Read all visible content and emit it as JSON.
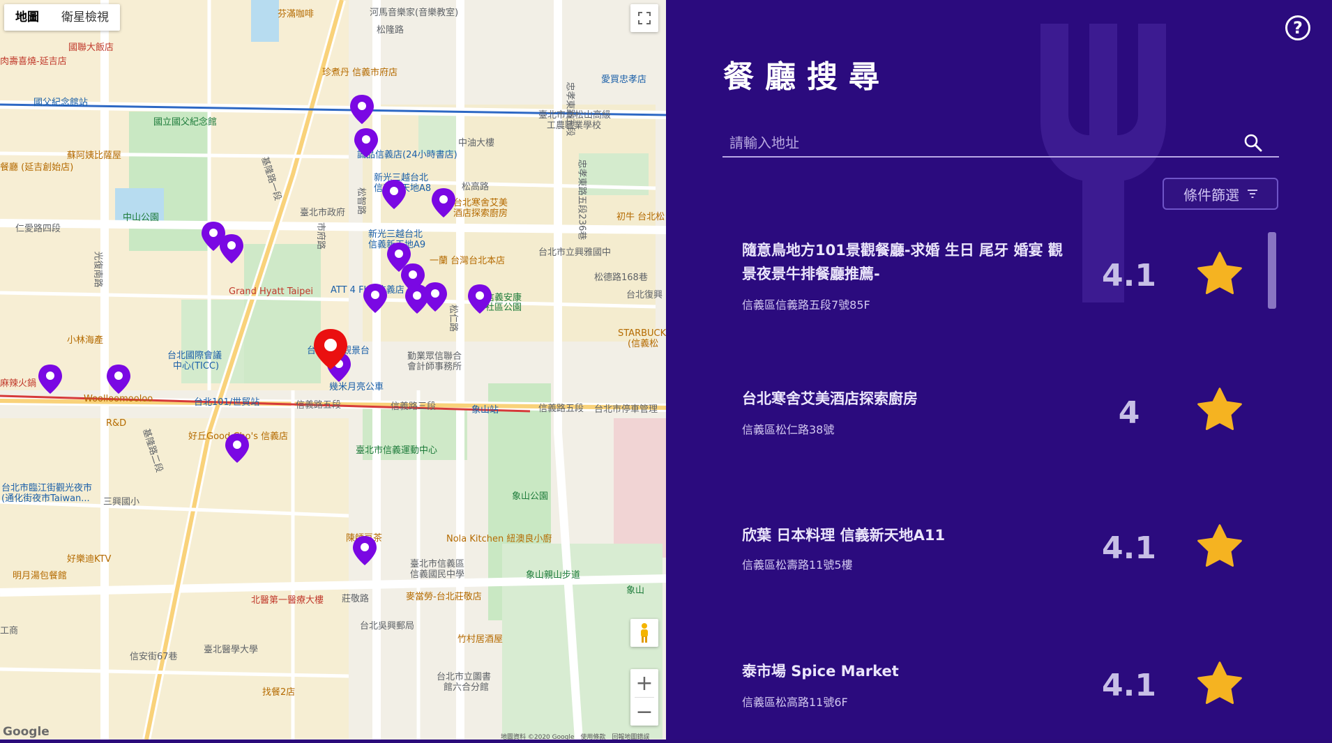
{
  "map": {
    "type_tabs": [
      "地圖",
      "衛星檢視"
    ],
    "google_logo": "Google",
    "attribution": "地圖資料 ©2020 Google　使用條款　回報地圖錯誤",
    "labels": [
      {
        "text": "芬滿咖啡",
        "cls": "lbl-orange"
      },
      {
        "text": "河馬音樂家(音樂教室)",
        "cls": "lbl-gray"
      },
      {
        "text": "松隆路",
        "cls": "lbl-gray"
      },
      {
        "text": "國聯大飯店",
        "cls": "lbl-red"
      },
      {
        "text": "肉壽喜燒-延吉店",
        "cls": "lbl-red"
      },
      {
        "text": "珍煮丹 信義市府店",
        "cls": "lbl-orange"
      },
      {
        "text": "愛買忠孝店",
        "cls": "lbl-blue"
      },
      {
        "text": "國父紀念館站",
        "cls": "lbl-blue"
      },
      {
        "text": "國立國父紀念館",
        "cls": "lbl-green"
      },
      {
        "text": "臺北市立松山高級",
        "cls": "lbl-gray"
      },
      {
        "text": "工農職業學校",
        "cls": "lbl-gray"
      },
      {
        "text": "中油大樓",
        "cls": "lbl-gray"
      },
      {
        "text": "誠品信義店(24小時書店)",
        "cls": "lbl-blue"
      },
      {
        "text": "蘇阿姨比薩屋",
        "cls": "lbl-orange"
      },
      {
        "text": "餐廳 (延吉創始店)",
        "cls": "lbl-orange"
      },
      {
        "text": "新光三越台北",
        "cls": "lbl-blue"
      },
      {
        "text": "信義新天地A8",
        "cls": "lbl-blue"
      },
      {
        "text": "松高路",
        "cls": "lbl-gray"
      },
      {
        "text": "台北寒舍艾美",
        "cls": "lbl-orange"
      },
      {
        "text": "酒店探索廚房",
        "cls": "lbl-orange"
      },
      {
        "text": "中山公園",
        "cls": "lbl-green"
      },
      {
        "text": "臺北市政府",
        "cls": "lbl-gray"
      },
      {
        "text": "初牛 台北松",
        "cls": "lbl-orange"
      },
      {
        "text": "仁愛路四段",
        "cls": "lbl-gray"
      },
      {
        "text": "新光三越台北",
        "cls": "lbl-blue"
      },
      {
        "text": "信義新天地A9",
        "cls": "lbl-blue"
      },
      {
        "text": "一蘭 台灣台北本店",
        "cls": "lbl-orange"
      },
      {
        "text": "台北市立興雅國中",
        "cls": "lbl-gray"
      },
      {
        "text": "松德路168巷",
        "cls": "lbl-gray"
      },
      {
        "text": "Grand Hyatt Taipei",
        "cls": "lbl-red"
      },
      {
        "text": "ATT 4 FUN信義店",
        "cls": "lbl-blue"
      },
      {
        "text": "信義安康",
        "cls": "lbl-green"
      },
      {
        "text": "社區公園",
        "cls": "lbl-green"
      },
      {
        "text": "台北復興",
        "cls": "lbl-gray"
      },
      {
        "text": "STARBUCKS",
        "cls": "lbl-orange"
      },
      {
        "text": "(信義松",
        "cls": "lbl-orange"
      },
      {
        "text": "小林海產",
        "cls": "lbl-orange"
      },
      {
        "text": "台北國際會議",
        "cls": "lbl-blue"
      },
      {
        "text": "中心(TICC)",
        "cls": "lbl-blue"
      },
      {
        "text": "台北101觀景台",
        "cls": "lbl-blue"
      },
      {
        "text": "勤業眾信聯合",
        "cls": "lbl-gray"
      },
      {
        "text": "會計師事務所",
        "cls": "lbl-gray"
      },
      {
        "text": "幾米月亮公車",
        "cls": "lbl-blue"
      },
      {
        "text": "麻辣火鍋",
        "cls": "lbl-red"
      },
      {
        "text": "Woolloomooloo",
        "cls": "lbl-orange"
      },
      {
        "text": "台北101/世貿站",
        "cls": "lbl-blue"
      },
      {
        "text": "信義路五段",
        "cls": "lbl-gray"
      },
      {
        "text": "信義路三段",
        "cls": "lbl-gray"
      },
      {
        "text": "象山站",
        "cls": "lbl-blue"
      },
      {
        "text": "信義路五段",
        "cls": "lbl-gray"
      },
      {
        "text": "台北市停車管理",
        "cls": "lbl-gray"
      },
      {
        "text": "R&D",
        "cls": "lbl-orange"
      },
      {
        "text": "好丘Good Cho's 信義店",
        "cls": "lbl-orange"
      },
      {
        "text": "臺北市信義運動中心",
        "cls": "lbl-green"
      },
      {
        "text": "台北市臨江街觀光夜市",
        "cls": "lbl-blue"
      },
      {
        "text": "(通化街夜市Taiwan...",
        "cls": "lbl-blue"
      },
      {
        "text": "三興國小",
        "cls": "lbl-gray"
      },
      {
        "text": "象山公園",
        "cls": "lbl-green"
      },
      {
        "text": "陳師豆茶",
        "cls": "lbl-orange"
      },
      {
        "text": "Nola Kitchen 紐澳良小廚",
        "cls": "lbl-orange"
      },
      {
        "text": "臺北市信義區",
        "cls": "lbl-gray"
      },
      {
        "text": "信義國民中學",
        "cls": "lbl-gray"
      },
      {
        "text": "好樂迪KTV",
        "cls": "lbl-orange"
      },
      {
        "text": "象山親山步道",
        "cls": "lbl-green"
      },
      {
        "text": "明月湯包餐館",
        "cls": "lbl-orange"
      },
      {
        "text": "麥當勞-台北莊敬店",
        "cls": "lbl-orange"
      },
      {
        "text": "北醫第一醫療大樓",
        "cls": "lbl-red"
      },
      {
        "text": "莊敬路",
        "cls": "lbl-gray"
      },
      {
        "text": "象山",
        "cls": "lbl-green"
      },
      {
        "text": "台北吳興郵局",
        "cls": "lbl-gray"
      },
      {
        "text": "竹村居酒屋",
        "cls": "lbl-orange"
      },
      {
        "text": "臺北醫學大學",
        "cls": "lbl-gray"
      },
      {
        "text": "信安街67巷",
        "cls": "lbl-gray"
      },
      {
        "text": "找餐2店",
        "cls": "lbl-orange"
      },
      {
        "text": "台北市立圖書",
        "cls": "lbl-gray"
      },
      {
        "text": "館六合分館",
        "cls": "lbl-gray"
      },
      {
        "text": "工商",
        "cls": "lbl-gray"
      },
      {
        "text": "基隆路一段",
        "cls": "lbl-gray"
      },
      {
        "text": "基隆路二段",
        "cls": "lbl-gray"
      },
      {
        "text": "光復南路",
        "cls": "lbl-gray"
      },
      {
        "text": "忠孝東路五段",
        "cls": "lbl-gray"
      },
      {
        "text": "松仁路",
        "cls": "lbl-gray"
      },
      {
        "text": "市府路",
        "cls": "lbl-gray"
      },
      {
        "text": "松智路",
        "cls": "lbl-gray"
      },
      {
        "text": "忠孝東路五段236巷",
        "cls": "lbl-gray"
      }
    ]
  },
  "panel": {
    "title": "餐廳搜尋",
    "search_placeholder": "請輸入地址",
    "filter_label": "條件篩選",
    "help_label": "?",
    "accent": "#2b0b7e",
    "star_color": "#f5b321",
    "restaurants": [
      {
        "name": "隨意鳥地方101景觀餐廳-求婚 生日 尾牙 婚宴 觀景夜景牛排餐廳推薦-",
        "address": "信義區信義路五段7號85F",
        "rating": "4.1"
      },
      {
        "name": "台北寒舍艾美酒店探索廚房",
        "address": "信義區松仁路38號",
        "rating": "4"
      },
      {
        "name": "欣葉 日本料理 信義新天地A11",
        "address": "信義區松壽路11號5樓",
        "rating": "4.1"
      },
      {
        "name": "泰市場 Spice Market",
        "address": "信義區松高路11號6F",
        "rating": "4.1"
      }
    ]
  }
}
